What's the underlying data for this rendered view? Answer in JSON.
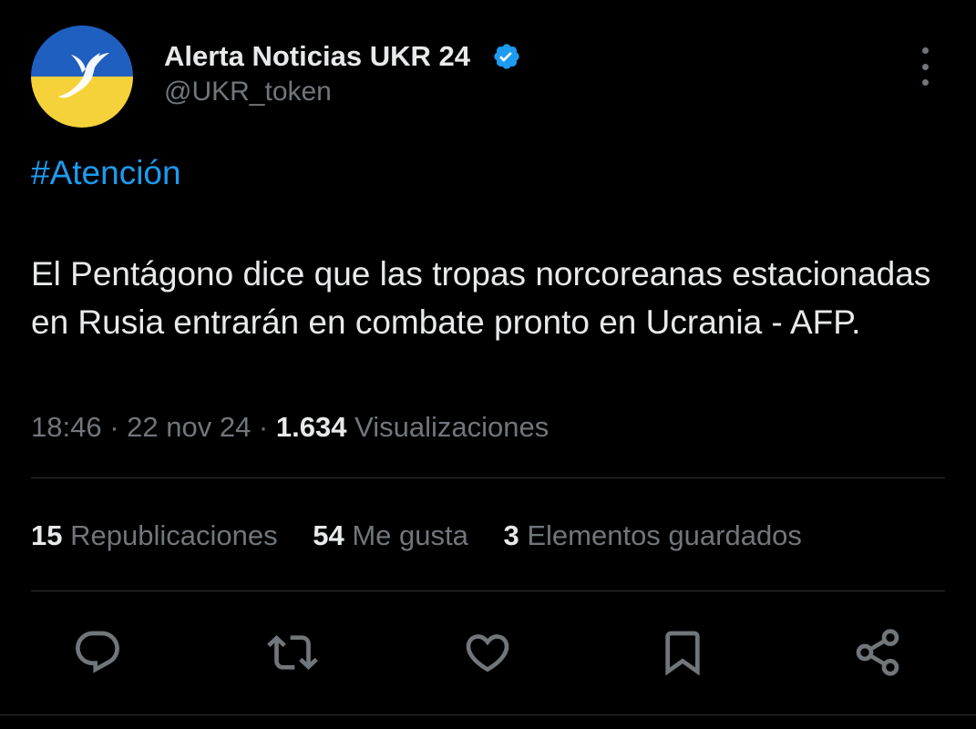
{
  "author": {
    "display_name": "Alerta Noticias UKR 24",
    "handle": "@UKR_token",
    "verified": true
  },
  "tweet": {
    "hashtag": "#Atención",
    "text": "El Pentágono dice que las tropas norcoreanas estacionadas en Rusia entrarán en combate pronto en Ucrania - AFP.",
    "time": "18:46",
    "date": "22 nov 24",
    "views_count": "1.634",
    "views_label": "Visualizaciones",
    "separator": " · "
  },
  "stats": {
    "reposts_count": "15",
    "reposts_label": "Republicaciones",
    "likes_count": "54",
    "likes_label": "Me gusta",
    "bookmarks_count": "3",
    "bookmarks_label": "Elementos guardados"
  },
  "actions": [
    "reply-icon",
    "repost-icon",
    "like-icon",
    "bookmark-icon",
    "share-icon"
  ],
  "colors": {
    "background": "#000000",
    "primary_text": "#e7e9ea",
    "secondary_text": "#71767b",
    "accent": "#1d9bf0",
    "flag_blue": "#1f5fbf",
    "flag_yellow": "#f5d23a"
  }
}
